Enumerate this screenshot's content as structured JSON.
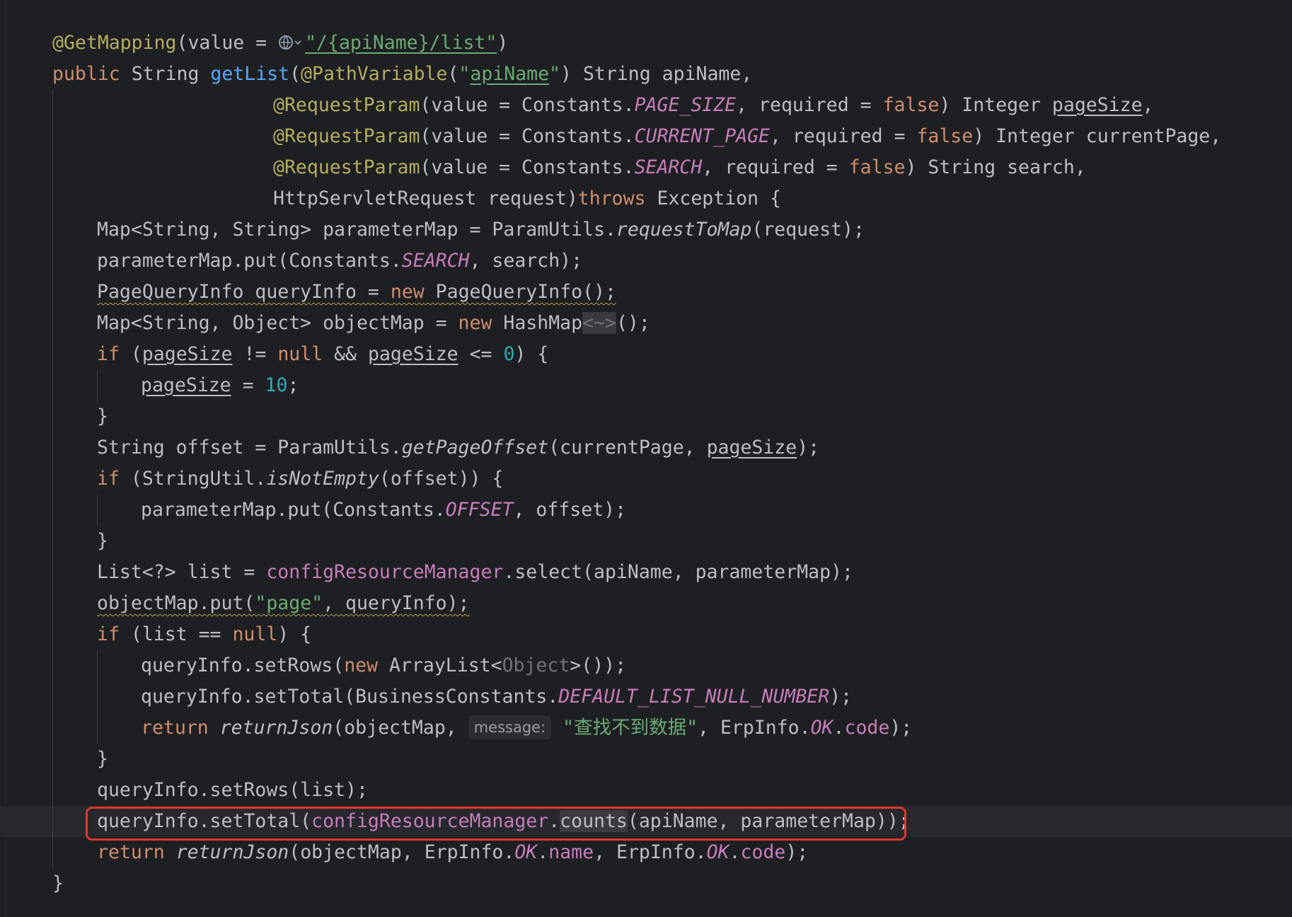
{
  "editor": {
    "lines": {
      "l1": {
        "annotation": "@GetMapping",
        "open": "(value = ",
        "path": "\"/{apiName}/list\"",
        "close": ")"
      },
      "l2": {
        "mod": "public",
        "t1": " String ",
        "method": "getList",
        "p1": "(",
        "ann": "@PathVariable",
        "p2": "(",
        "q1": "\"",
        "param": "apiName",
        "q2": "\"",
        "rest": ") String apiName,"
      },
      "l3": {
        "ann": "@RequestParam",
        "a": "(value = Constants.",
        "const": "PAGE_SIZE",
        "b": ", required = ",
        "bool": "false",
        "c": ") Integer ",
        "var": "pageSize",
        "d": ","
      },
      "l4": {
        "ann": "@RequestParam",
        "a": "(value = Constants.",
        "const": "CURRENT_PAGE",
        "b": ", required = ",
        "bool": "false",
        "c": ") Integer currentPage,"
      },
      "l5": {
        "ann": "@RequestParam",
        "a": "(value = Constants.",
        "const": "SEARCH",
        "b": ", required = ",
        "bool": "false",
        "c": ") String search,"
      },
      "l6": {
        "a": "HttpServletRequest request)",
        "kw": "throws",
        "b": " Exception {"
      },
      "l7": {
        "a": "Map<String, String> parameterMap = ParamUtils.",
        "fn": "requestToMap",
        "b": "(request);"
      },
      "l8": {
        "a": "parameterMap.put(Constants.",
        "const": "SEARCH",
        "b": ", search);"
      },
      "l9": {
        "a": "PageQueryInfo queryInfo = ",
        "kw": "new",
        "b": " PageQueryInfo();"
      },
      "l10": {
        "a": "Map<String, Object> objectMap = ",
        "kw": "new",
        "b": " HashMap",
        "diamond": "<~>",
        "c": "();"
      },
      "l11": {
        "kw": "if",
        "a": " (",
        "var1": "pageSize",
        "b": " != ",
        "null": "null",
        "c": " && ",
        "var2": "pageSize",
        "d": " <= ",
        "num": "0",
        "e": ") {"
      },
      "l12": {
        "var": "pageSize",
        "a": " = ",
        "num": "10",
        "b": ";"
      },
      "l13": {
        "a": "}"
      },
      "l14": {
        "a": "String offset = ParamUtils.",
        "fn": "getPageOffset",
        "b": "(currentPage, ",
        "var": "pageSize",
        "c": ");"
      },
      "l15": {
        "kw": "if",
        "a": " (StringUtil.",
        "fn": "isNotEmpty",
        "b": "(offset)) {"
      },
      "l16": {
        "a": "parameterMap.put(Constants.",
        "const": "OFFSET",
        "b": ", offset);"
      },
      "l17": {
        "a": "}"
      },
      "l18": {
        "a": "List<?> list = ",
        "field": "configResourceManager",
        "b": ".select(apiName, parameterMap);"
      },
      "l19": {
        "a": "objectMap.put(",
        "str": "\"page\"",
        "b": ", queryInfo);"
      },
      "l20": {
        "kw": "if",
        "a": " (list == ",
        "null": "null",
        "b": ") {"
      },
      "l21": {
        "a": "queryInfo.setRows(",
        "kw": "new",
        "b": " ArrayList<",
        "dim": "Object",
        "c": ">());"
      },
      "l22": {
        "a": "queryInfo.setTotal(BusinessConstants.",
        "const": "DEFAULT_LIST_NULL_NUMBER",
        "b": ");"
      },
      "l23": {
        "kw": "return",
        "sp": " ",
        "fn": "returnJson",
        "a": "(objectMap, ",
        "hint": "message:",
        "str": "\"查找不到数据\"",
        "b": ", ErpInfo.",
        "const": "OK",
        "c": ".",
        "field": "code",
        "d": ");"
      },
      "l24": {
        "a": "}"
      },
      "l25": {
        "a": "queryInfo.setRows(list);"
      },
      "l26": {
        "a": "queryInfo.setTotal(",
        "field": "configResourceManager",
        "b": ".",
        "method": "counts",
        "c": "(apiName, parameterMap));"
      },
      "l27": {
        "kw": "return",
        "sp": " ",
        "fn": "returnJson",
        "a": "(objectMap, ErpInfo.",
        "const1": "OK",
        "b": ".",
        "field1": "name",
        "c": ", ErpInfo.",
        "const2": "OK",
        "d": ".",
        "field2": "code",
        "e": ");"
      },
      "l28": {
        "a": "}"
      }
    },
    "icons": {
      "url_globe": "globe-icon"
    },
    "colors": {
      "background": "#1e1f22",
      "current_line": "#26282e",
      "highlight_box": "#e0382b"
    }
  }
}
